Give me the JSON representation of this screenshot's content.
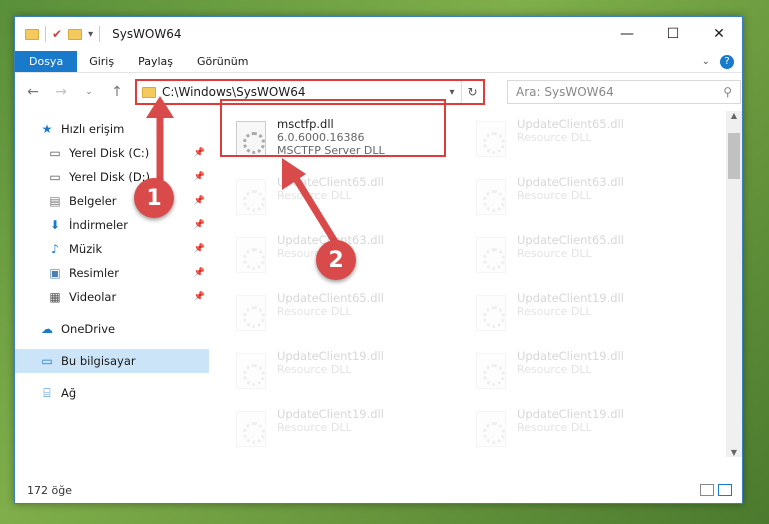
{
  "window": {
    "title": "SysWOW64",
    "controls": {
      "minimize": "—",
      "maximize": "☐",
      "close": "✕"
    }
  },
  "ribbon": {
    "tabs": [
      "Dosya",
      "Giriş",
      "Paylaş",
      "Görünüm"
    ],
    "help": "?"
  },
  "navigation": {
    "address": "C:\\Windows\\SysWOW64",
    "search_placeholder": "Ara: SysWOW64"
  },
  "sidebar": {
    "quick_access": "Hızlı erişim",
    "items": [
      {
        "label": "Yerel Disk (C:)",
        "icon": "drive-icon"
      },
      {
        "label": "Yerel Disk (D:)",
        "icon": "drive-icon"
      },
      {
        "label": "Belgeler",
        "icon": "documents-icon"
      },
      {
        "label": "İndirmeler",
        "icon": "downloads-icon"
      },
      {
        "label": "Müzik",
        "icon": "music-icon"
      },
      {
        "label": "Resimler",
        "icon": "pictures-icon"
      },
      {
        "label": "Videolar",
        "icon": "videos-icon"
      }
    ],
    "onedrive": "OneDrive",
    "this_pc": "Bu bilgisayar",
    "network": "Ağ"
  },
  "files": [
    {
      "name": "msctfp.dll",
      "line2": "6.0.6000.16386",
      "line3": "MSCTFP Server DLL",
      "highlighted": true
    },
    {
      "name": "UpdateClient65.dll",
      "line2": "Resource DLL",
      "line3": ""
    },
    {
      "name": "UpdateClient65.dll",
      "line2": "Resource DLL",
      "line3": ""
    },
    {
      "name": "UpdateClient63.dll",
      "line2": "Resource DLL",
      "line3": ""
    },
    {
      "name": "UpdateClient63.dll",
      "line2": "Resource DLL",
      "line3": ""
    },
    {
      "name": "UpdateClient65.dll",
      "line2": "Resource DLL",
      "line3": ""
    },
    {
      "name": "UpdateClient65.dll",
      "line2": "Resource DLL",
      "line3": ""
    },
    {
      "name": "UpdateClient19.dll",
      "line2": "Resource DLL",
      "line3": ""
    },
    {
      "name": "UpdateClient19.dll",
      "line2": "Resource DLL",
      "line3": ""
    },
    {
      "name": "UpdateClient19.dll",
      "line2": "Resource DLL",
      "line3": ""
    },
    {
      "name": "UpdateClient19.dll",
      "line2": "Resource DLL",
      "line3": ""
    },
    {
      "name": "UpdateClient19.dll",
      "line2": "Resource DLL",
      "line3": ""
    }
  ],
  "status": {
    "count": "172 öğe"
  },
  "markers": [
    "1",
    "2"
  ],
  "colors": {
    "accent": "#1979ca",
    "highlight": "#e03b3b",
    "marker": "#d94a4a"
  }
}
